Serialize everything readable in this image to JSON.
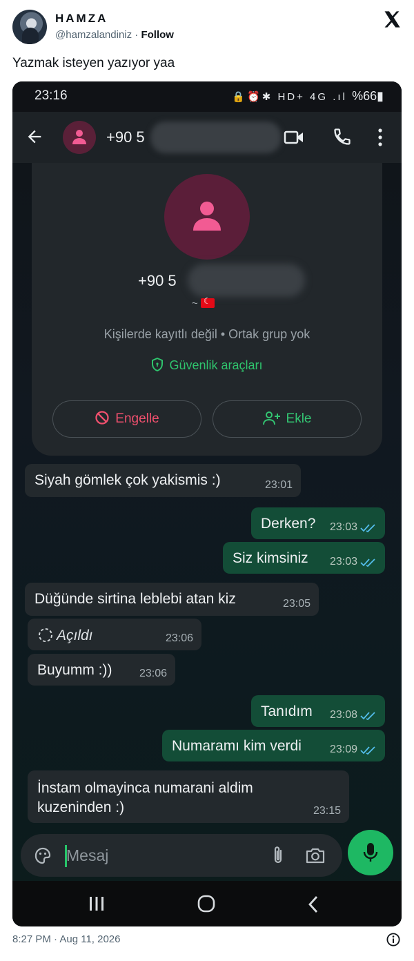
{
  "tweet": {
    "author_name": "HAMZA",
    "handle": "@hamzalandiniz",
    "separator": "·",
    "follow_label": "Follow",
    "text": "Yazmak isteyen yazıyor yaa",
    "timestamp": "8:27 PM · Aug 11, 2026"
  },
  "phone": {
    "status": {
      "time": "23:16",
      "icons": "🔒⏰✱ HD+ 4G .ıl",
      "battery": "%66▮"
    },
    "appbar": {
      "number_prefix": "+90 5"
    },
    "card": {
      "number_prefix": "+90 5",
      "flag_prefix": "~",
      "info": "Kişilerde kayıtlı değil • Ortak grup yok",
      "safety_label": "Güvenlik araçları",
      "block_label": "Engelle",
      "add_label": "Ekle"
    },
    "messages": [
      {
        "dir": "in",
        "text": "Siyah gömlek çok yakismis :)",
        "time": "23:01"
      },
      {
        "dir": "out",
        "text": "Derken?",
        "time": "23:03"
      },
      {
        "dir": "out",
        "text": "Siz kimsiniz",
        "time": "23:03"
      },
      {
        "dir": "in",
        "text": "Düğünde sirtina leblebi atan kiz",
        "time": "23:05"
      },
      {
        "dir": "in",
        "text": "Açıldı",
        "time": "23:06"
      },
      {
        "dir": "in",
        "text": "Buyumm :))",
        "time": "23:06"
      },
      {
        "dir": "out",
        "text": "Tanıdım",
        "time": "23:08"
      },
      {
        "dir": "out",
        "text": "Numaramı kim verdi",
        "time": "23:09"
      },
      {
        "dir": "in",
        "text_line1": "İnstam olmayinca numarani aldim",
        "text_line2": "kuzeninden :)",
        "time": "23:15"
      }
    ],
    "input": {
      "placeholder": "Mesaj"
    }
  },
  "colors": {
    "outgoing_bubble": "#134d37",
    "incoming_bubble": "#23292d",
    "accent_green": "#1eb863",
    "block_red": "#f0506e"
  }
}
